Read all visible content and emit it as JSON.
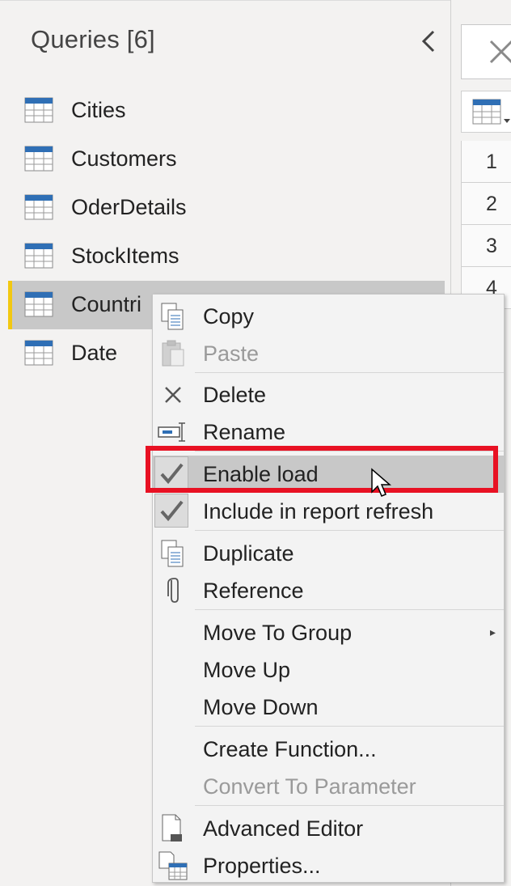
{
  "queries_pane": {
    "title": "Queries [6]",
    "items": [
      {
        "label": "Cities"
      },
      {
        "label": "Customers"
      },
      {
        "label": "OderDetails"
      },
      {
        "label": "StockItems"
      },
      {
        "label": "Countri",
        "selected": true
      },
      {
        "label": "Date"
      }
    ]
  },
  "grid": {
    "row_numbers": [
      "1",
      "2",
      "3",
      "4"
    ]
  },
  "context_menu": {
    "copy": "Copy",
    "paste": "Paste",
    "delete": "Delete",
    "rename": "Rename",
    "enable_load": "Enable load",
    "include_refresh": "Include in report refresh",
    "duplicate": "Duplicate",
    "reference": "Reference",
    "move_to_group": "Move To Group",
    "move_up": "Move Up",
    "move_down": "Move Down",
    "create_function": "Create Function...",
    "convert_to_parameter": "Convert To Parameter",
    "advanced_editor": "Advanced Editor",
    "properties": "Properties..."
  },
  "colors": {
    "accent_yellow": "#f2c811",
    "highlight_red": "#e81123",
    "table_icon_blue": "#2f6fb5"
  }
}
